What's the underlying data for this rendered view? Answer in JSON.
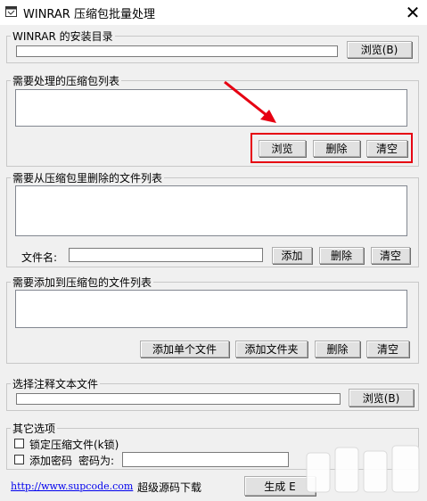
{
  "window": {
    "title": "WINRAR 压缩包批量处理",
    "close_glyph": "✕"
  },
  "install_dir": {
    "label": "WINRAR 的安装目录",
    "value": "",
    "browse": "浏览(B)"
  },
  "archives": {
    "label": "需要处理的压缩包列表",
    "browse": "浏览",
    "delete": "删除",
    "clear": "清空"
  },
  "remove_files": {
    "label": "需要从压缩包里删除的文件列表",
    "filename_label": "文件名:",
    "filename_value": "",
    "add": "添加",
    "delete": "删除",
    "clear": "清空"
  },
  "add_files": {
    "label": "需要添加到压缩包的文件列表",
    "add_single": "添加单个文件",
    "add_folder": "添加文件夹",
    "delete": "删除",
    "clear": "清空"
  },
  "comment": {
    "label": "选择注释文本文件",
    "value": "",
    "browse": "浏览(B)"
  },
  "other": {
    "label": "其它选项",
    "lock_label": "锁定压缩文件(k锁)",
    "lock_checked": false,
    "password_label": "添加密码",
    "password_field_label": "密码为:",
    "password_value": ""
  },
  "footer": {
    "link": "http://www.supcode.com",
    "download_label": "超级源码下载",
    "generate": "生成 E"
  },
  "colors": {
    "highlight": "#e60012",
    "link": "#0000ee"
  },
  "icons": {
    "app": "app-icon",
    "close": "close-icon",
    "arrow": "red-arrow-annotation"
  }
}
